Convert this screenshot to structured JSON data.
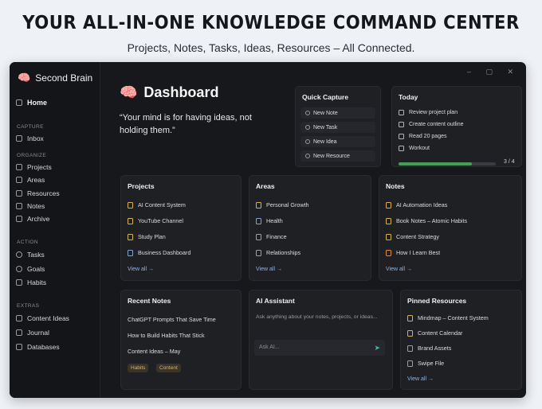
{
  "hero": {
    "title": "YOUR ALL-IN-ONE KNOWLEDGE COMMAND CENTER",
    "subtitle": "Projects, Notes, Tasks, Ideas, Resources – All Connected."
  },
  "window": {
    "controls": "– ▢ ✕"
  },
  "sidebar": {
    "brand": "Second Brain",
    "home": "Home",
    "sections": {
      "capture": "CAPTURE",
      "organize": "ORGANIZE",
      "action": "ACTION",
      "extras": "EXTRAS"
    },
    "capture_items": [
      "Inbox"
    ],
    "organize_items": [
      "Projects",
      "Areas",
      "Resources",
      "Notes",
      "Archive"
    ],
    "action_items": [
      "Tasks",
      "Goals",
      "Habits"
    ],
    "extras_items": [
      "Content Ideas",
      "Journal",
      "Databases"
    ]
  },
  "dashboard": {
    "title": "Dashboard",
    "quote": "“Your mind is for having ideas, not holding them.”"
  },
  "quick_capture": {
    "title": "Quick Capture",
    "buttons": [
      "New Note",
      "New Task",
      "New Idea",
      "New Resource"
    ]
  },
  "today": {
    "title": "Today",
    "tasks": [
      "Review project plan",
      "Create content outline",
      "Read 20 pages",
      "Workout"
    ],
    "progress_text": "3 / 4",
    "progress_fraction": 0.75
  },
  "projects": {
    "title": "Projects",
    "items": [
      "AI Content System",
      "YouTube Channel",
      "Study Plan",
      "Business Dashboard"
    ],
    "view_all": "View all →"
  },
  "areas": {
    "title": "Areas",
    "items": [
      "Personal Growth",
      "Health",
      "Finance",
      "Relationships"
    ],
    "view_all": "View all →"
  },
  "notes": {
    "title": "Notes",
    "items": [
      "AI Automation Ideas",
      "Book Notes – Atomic Habits",
      "Content Strategy",
      "How I Learn Best"
    ],
    "view_all": "View all →"
  },
  "recent_notes": {
    "title": "Recent Notes",
    "items": [
      "ChatGPT Prompts That Save Time",
      "How to Build Habits That Stick",
      "Content Ideas – May"
    ],
    "tags": [
      "Habits",
      "Content"
    ]
  },
  "ai_assistant": {
    "title": "AI Assistant",
    "description": "Ask anything about your notes, projects, or ideas...",
    "placeholder": "Ask AI..."
  },
  "pinned_resources": {
    "title": "Pinned Resources",
    "items": [
      "Mindmap – Content System",
      "Content Calendar",
      "Brand Assets",
      "Swipe File"
    ],
    "view_all": "View all →"
  },
  "colors": {
    "progress": "#3fa34d",
    "link": "#8fb4e6",
    "tag_text": "#d4b66a",
    "icon_yellow": "#d8b24a",
    "icon_blue": "#7aa3d8",
    "icon_orange": "#d98a3a",
    "icon_gray": "#9aa0a8"
  }
}
